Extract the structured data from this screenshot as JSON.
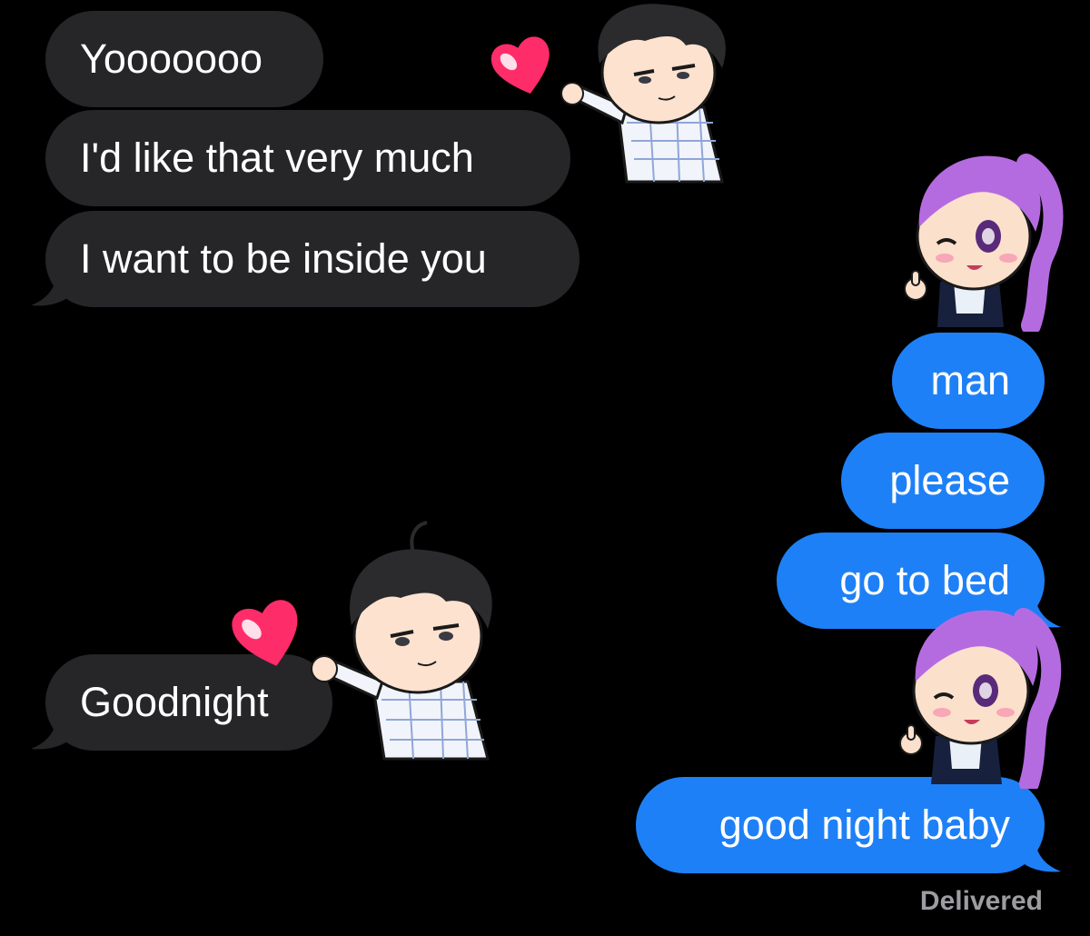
{
  "colors": {
    "background": "#000000",
    "incoming_bubble": "#262629",
    "outgoing_bubble": "#1e80f7",
    "bubble_text": "#ffffff",
    "status_text": "#9c9ca1"
  },
  "messages": [
    {
      "direction": "incoming",
      "text": "Yooooooo"
    },
    {
      "direction": "incoming",
      "text": "I'd like that very much"
    },
    {
      "direction": "incoming",
      "text": "I want to be inside you"
    },
    {
      "direction": "outgoing",
      "text": "man"
    },
    {
      "direction": "outgoing",
      "text": "please"
    },
    {
      "direction": "outgoing",
      "text": "go to bed"
    },
    {
      "direction": "incoming",
      "text": "Goodnight"
    },
    {
      "direction": "outgoing",
      "text": "good night baby"
    }
  ],
  "stickers": [
    {
      "icon": "boy-heart-sticker-icon"
    },
    {
      "icon": "girl-thumbs-up-sticker-icon"
    },
    {
      "icon": "boy-heart-sticker-icon"
    },
    {
      "icon": "girl-thumbs-up-sticker-icon"
    }
  ],
  "status": "Delivered"
}
